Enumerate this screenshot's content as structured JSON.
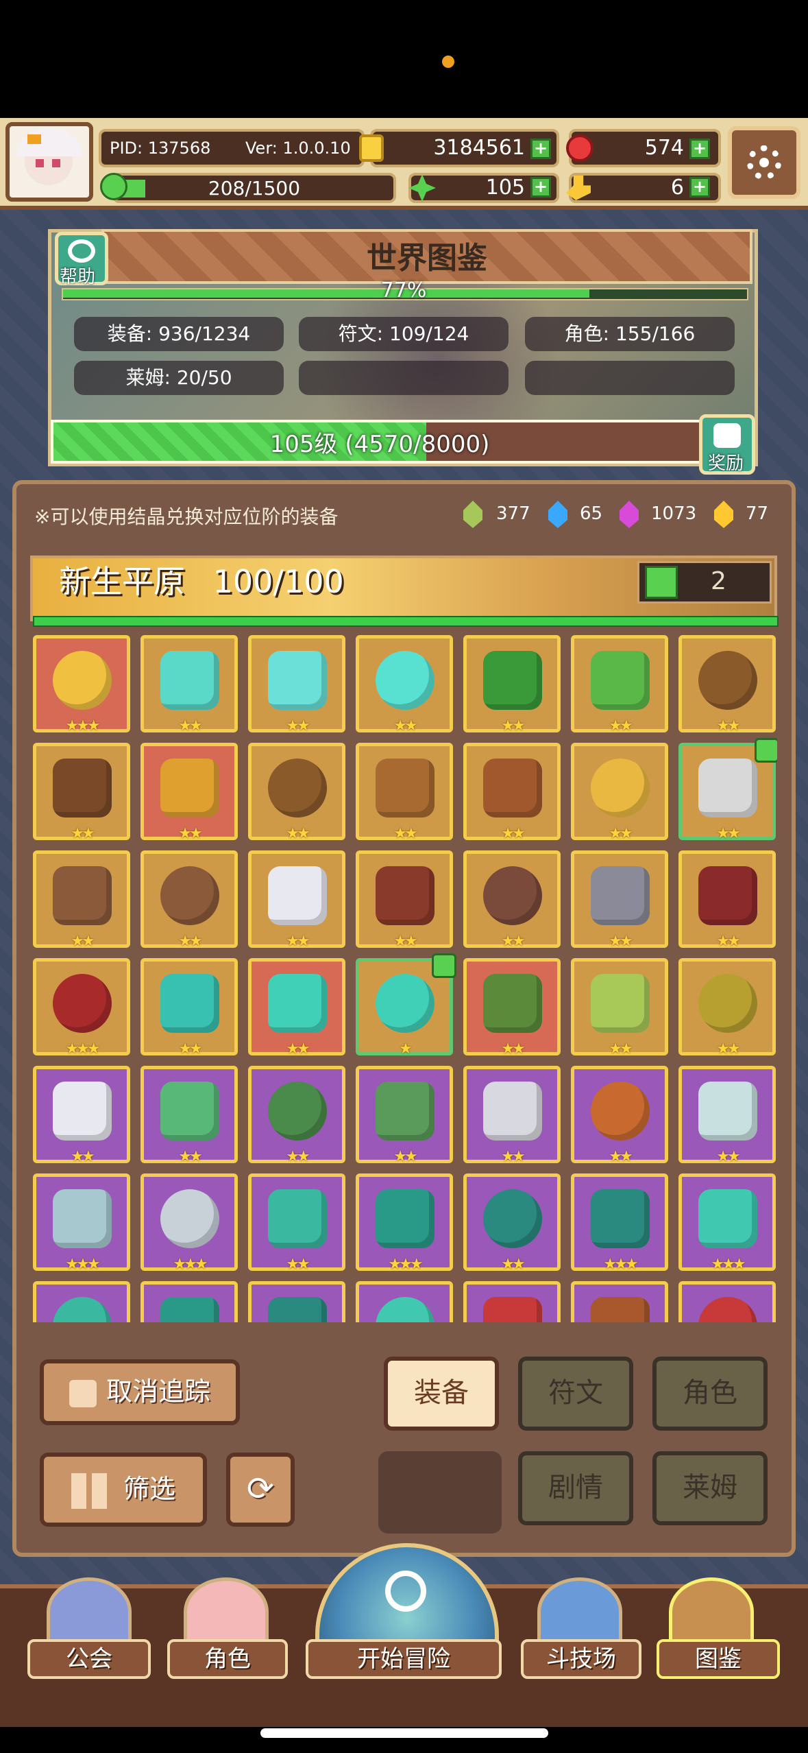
{
  "profile": {
    "pid": "PID: 137568",
    "ver": "Ver: 1.0.0.10",
    "exp": "208/1500"
  },
  "currency": {
    "gold": "3184561",
    "ruby": "574",
    "clover": "105",
    "key": "6"
  },
  "world": {
    "title": "世界图鉴",
    "help_label": "帮助",
    "progress_text": "77%",
    "progress_value": 0.77,
    "stats": [
      "装备: 936/1234",
      "符文: 109/124",
      "角色: 155/166",
      "莱姆: 20/50"
    ],
    "level_text": "105级 (4570/8000)",
    "level_progress": 0.571,
    "reward_label": "奖励"
  },
  "collection": {
    "hint": "※可以使用结晶兑换对应位阶的装备",
    "crystals": [
      {
        "value": "377",
        "color": "#a6c85a"
      },
      {
        "value": "65",
        "color": "#3aa8ff"
      },
      {
        "value": "1073",
        "color": "#d84ad8"
      },
      {
        "value": "77",
        "color": "#ffc830"
      }
    ],
    "region": "新生平原",
    "region_count": "100/100",
    "likes": "2"
  },
  "grid": [
    {
      "bg": "red",
      "stars": "★★★",
      "icon": "straw-hat-icon",
      "color": "#f0c040"
    },
    {
      "bg": "gold",
      "stars": "★★",
      "icon": "mace-icon",
      "color": "#5ad8c8"
    },
    {
      "bg": "gold",
      "stars": "★★",
      "icon": "orb-icon",
      "color": "#6ae0d8"
    },
    {
      "bg": "gold",
      "stars": "★★",
      "icon": "crystal-icon",
      "color": "#58e0d0"
    },
    {
      "bg": "gold",
      "stars": "★★",
      "icon": "leaf-helmet-icon",
      "color": "#3a9a3a"
    },
    {
      "bg": "gold",
      "stars": "★★",
      "icon": "leaf-armor-icon",
      "color": "#5ab848"
    },
    {
      "bg": "gold",
      "stars": "★★",
      "icon": "ring-icon",
      "color": "#8a5a2a"
    },
    {
      "bg": "gold",
      "stars": "★★",
      "icon": "crossbow-icon",
      "color": "#7a4a28"
    },
    {
      "bg": "red",
      "stars": "★★",
      "icon": "spear-icon",
      "color": "#e0a030"
    },
    {
      "bg": "gold",
      "stars": "★★",
      "icon": "amulet-icon",
      "color": "#8a5a2a"
    },
    {
      "bg": "gold",
      "stars": "★★",
      "icon": "horn-icon",
      "color": "#a86a30"
    },
    {
      "bg": "gold",
      "stars": "★★",
      "icon": "bracelet-icon",
      "color": "#a0582c"
    },
    {
      "bg": "gold",
      "stars": "★★",
      "icon": "gem-ring-icon",
      "color": "#e8b840"
    },
    {
      "bg": "gold",
      "stars": "★★",
      "icon": "axe-icon",
      "color": "#d8d8d8",
      "sel": true
    },
    {
      "bg": "gold",
      "stars": "★★",
      "icon": "fur-ring-icon",
      "color": "#8a5a3a"
    },
    {
      "bg": "gold",
      "stars": "★★",
      "icon": "jar-icon",
      "color": "#8a5a3a"
    },
    {
      "bg": "gold",
      "stars": "★★",
      "icon": "pearl-icon",
      "color": "#e8e8f0"
    },
    {
      "bg": "gold",
      "stars": "★★",
      "icon": "hammer-icon",
      "color": "#8a3a2a"
    },
    {
      "bg": "gold",
      "stars": "★★",
      "icon": "necklace-icon",
      "color": "#7a4a3a"
    },
    {
      "bg": "gold",
      "stars": "★★",
      "icon": "sword-icon",
      "color": "#8a8a98"
    },
    {
      "bg": "gold",
      "stars": "★★",
      "icon": "hood-icon",
      "color": "#8a2a2a"
    },
    {
      "bg": "gold",
      "stars": "★★★",
      "icon": "red-armor-icon",
      "color": "#a82a2a"
    },
    {
      "bg": "gold",
      "stars": "★★",
      "icon": "bow-icon",
      "color": "#38c0b0"
    },
    {
      "bg": "red",
      "stars": "★★",
      "icon": "arrow-icon",
      "color": "#40d0b8"
    },
    {
      "bg": "gold",
      "stars": "★",
      "icon": "boots-icon",
      "color": "#40d0b8",
      "sel": true
    },
    {
      "bg": "red",
      "stars": "★★",
      "icon": "helmet-icon",
      "color": "#5a8a3a"
    },
    {
      "bg": "gold",
      "stars": "★★",
      "icon": "scroll-icon",
      "color": "#a8c858"
    },
    {
      "bg": "gold",
      "stars": "★★",
      "icon": "mask-icon",
      "color": "#b8a030"
    },
    {
      "bg": "purple",
      "stars": "★★",
      "icon": "sword-icon",
      "color": "#e8e8f0"
    },
    {
      "bg": "purple",
      "stars": "★★",
      "icon": "hood-icon",
      "color": "#58b878"
    },
    {
      "bg": "purple",
      "stars": "★★",
      "icon": "armor-icon",
      "color": "#4a8a4a"
    },
    {
      "bg": "purple",
      "stars": "★★",
      "icon": "crossbow-icon",
      "color": "#5a9a5a"
    },
    {
      "bg": "purple",
      "stars": "★★",
      "icon": "spear-icon",
      "color": "#d8d8e0"
    },
    {
      "bg": "purple",
      "stars": "★★",
      "icon": "gloves-icon",
      "color": "#c86a30"
    },
    {
      "bg": "purple",
      "stars": "★★",
      "icon": "chainmail-icon",
      "color": "#c8e0e0"
    },
    {
      "bg": "purple",
      "stars": "★★★",
      "icon": "ring-icon",
      "color": "#a8c8d0"
    },
    {
      "bg": "purple",
      "stars": "★★★",
      "icon": "boots-icon",
      "color": "#c8d0d8"
    },
    {
      "bg": "purple",
      "stars": "★★",
      "icon": "mace-icon",
      "color": "#3ab8a0"
    },
    {
      "bg": "purple",
      "stars": "★★★",
      "icon": "wizard-hat-icon",
      "color": "#2a9a88"
    },
    {
      "bg": "purple",
      "stars": "★★",
      "icon": "teal-armor-icon",
      "color": "#2a8a80"
    },
    {
      "bg": "purple",
      "stars": "★★★",
      "icon": "bracer-icon",
      "color": "#2a8a80"
    },
    {
      "bg": "purple",
      "stars": "★★★",
      "icon": "diamond-icon",
      "color": "#40c8b0"
    },
    {
      "bg": "purple",
      "stars": "",
      "icon": "item-icon",
      "color": "#3ab8a0"
    },
    {
      "bg": "purple",
      "stars": "",
      "icon": "item-icon",
      "color": "#2a9a88"
    },
    {
      "bg": "purple",
      "stars": "",
      "icon": "item-icon",
      "color": "#2a8a80"
    },
    {
      "bg": "purple",
      "stars": "",
      "icon": "item-icon",
      "color": "#40c8b0"
    },
    {
      "bg": "purple",
      "stars": "",
      "icon": "item-icon",
      "color": "#c83a3a"
    },
    {
      "bg": "purple",
      "stars": "",
      "icon": "item-icon",
      "color": "#a8582c"
    },
    {
      "bg": "purple",
      "stars": "",
      "icon": "item-icon",
      "color": "#c83a3a"
    }
  ],
  "buttons": {
    "untrack": "取消追踪",
    "filter": "筛选",
    "tabs": [
      "装备",
      "符文",
      "角色",
      "剧情",
      "莱姆"
    ]
  },
  "nav": [
    "公会",
    "角色",
    "开始冒险",
    "斗技场",
    "图鉴"
  ]
}
